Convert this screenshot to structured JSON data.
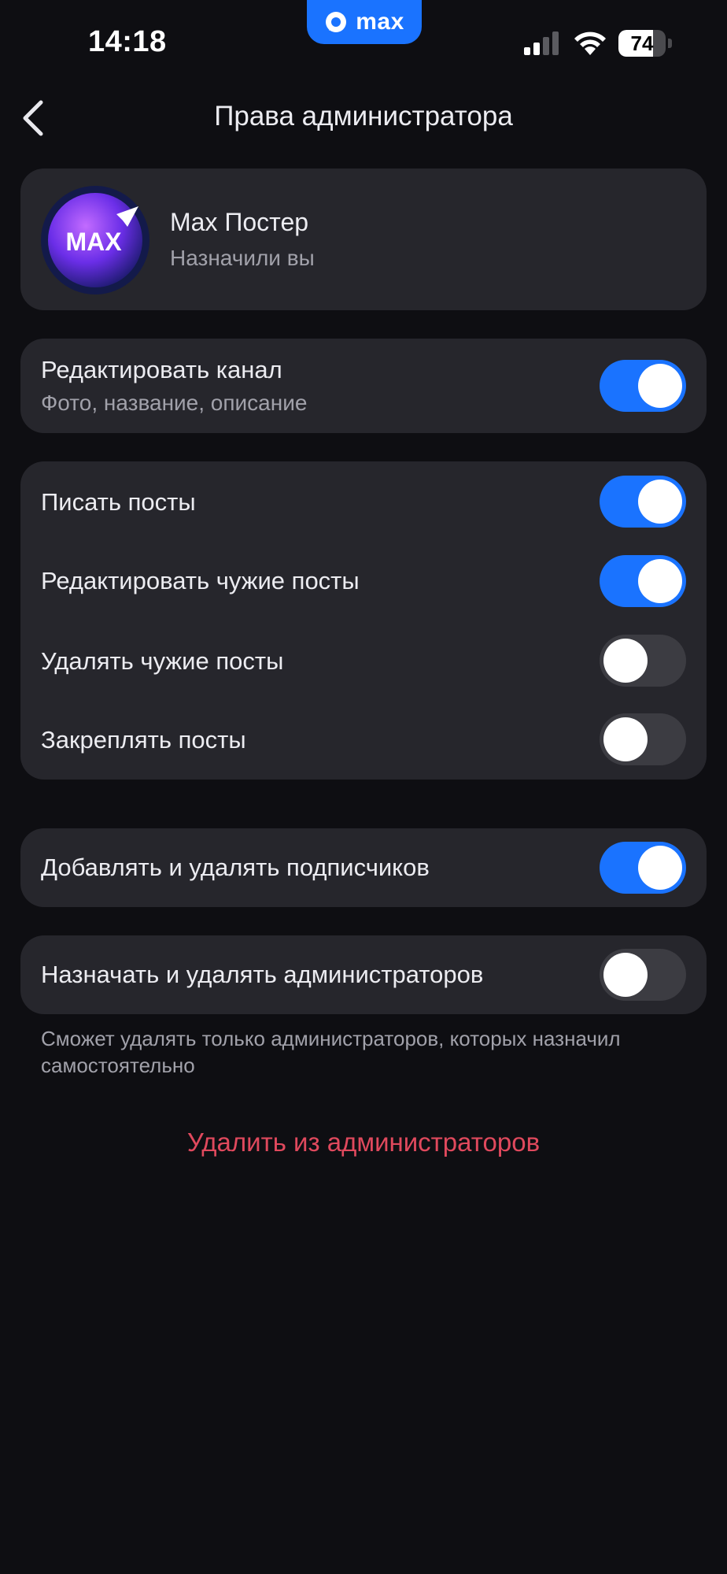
{
  "status_bar": {
    "time": "14:18",
    "app_badge": "max",
    "battery_level": "74",
    "battery_percent": 74
  },
  "nav": {
    "back_icon": "chevron-left-icon",
    "title": "Права администратора"
  },
  "profile": {
    "avatar_text": "MAX",
    "name": "Max Постер",
    "subtitle": "Назначили вы"
  },
  "permissions": {
    "edit_channel": {
      "label": "Редактировать канал",
      "subtitle": "Фото, название, описание",
      "enabled": true
    },
    "posts": [
      {
        "label": "Писать посты",
        "enabled": true
      },
      {
        "label": "Редактировать чужие посты",
        "enabled": true
      },
      {
        "label": "Удалять чужие посты",
        "enabled": false
      },
      {
        "label": "Закреплять посты",
        "enabled": false
      }
    ],
    "subscribers": {
      "label": "Добавлять и удалять подписчиков",
      "enabled": true
    },
    "admins": {
      "label": "Назначать и удалять администраторов",
      "enabled": false
    }
  },
  "hint": "Сможет удалять только администраторов, которых назначил самостоятельно",
  "remove_button": "Удалить из администраторов",
  "colors": {
    "accent": "#1a73ff",
    "danger": "#e0495d",
    "background": "#0e0e12",
    "card": "#26262c"
  }
}
